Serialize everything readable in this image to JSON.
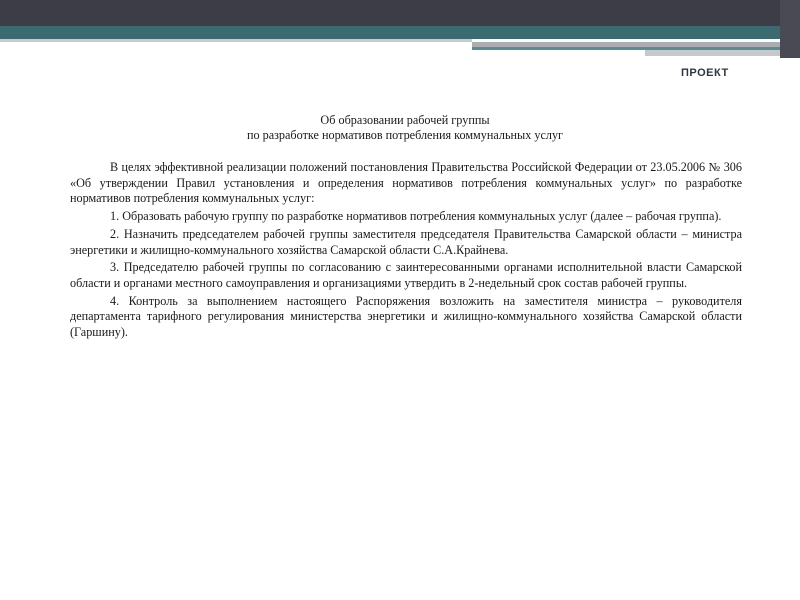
{
  "header": {
    "stamp": "ПРОЕКТ"
  },
  "document": {
    "title": {
      "line1": "Об образовании рабочей группы",
      "line2": "по разработке нормативов потребления коммунальных услуг"
    },
    "paragraphs": [
      "В целях эффективной реализации положений постановления Правительства Российской Федерации от 23.05.2006 № 306 «Об утверждении Правил установления и определения нормативов потребления коммунальных услуг» по разработке нормативов потребления коммунальных услуг:",
      "1. Образовать рабочую группу по разработке нормативов потребления коммунальных услуг (далее – рабочая группа).",
      "2. Назначить председателем рабочей группы заместителя председателя Правительства Самарской области – министра энергетики и жилищно-коммунального хозяйства Самарской области С.А.Крайнева.",
      "3. Председателю рабочей группы по согласованию с заинтересованными органами исполнительной власти Самарской области и органами местного самоуправления и организациями утвердить в 2-недельный срок состав рабочей группы.",
      "4. Контроль за выполнением настоящего Распоряжения возложить на заместителя министра – руководителя департамента тарифного регулирования министерства энергетики и жилищно-коммунального хозяйства Самарской области (Гаршину)."
    ]
  }
}
